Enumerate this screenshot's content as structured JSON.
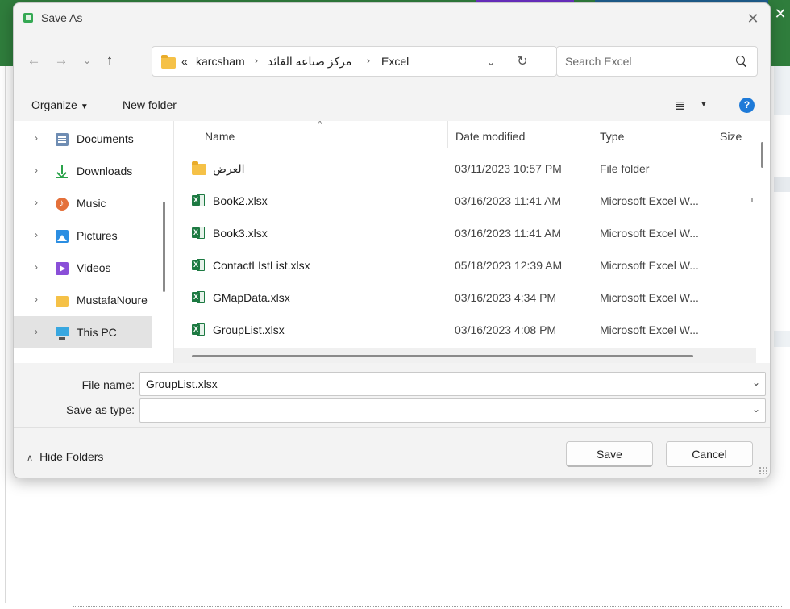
{
  "window": {
    "title": "Save As"
  },
  "address": {
    "overflow": "«",
    "crumbs": [
      "karcsham",
      "مركز صناعة القائد",
      "Excel"
    ],
    "separator": "›"
  },
  "search": {
    "placeholder": "Search Excel"
  },
  "toolbar": {
    "organize": "Organize",
    "new_folder": "New folder",
    "view_icon": "≣",
    "help": "?"
  },
  "sidebar": {
    "items": [
      {
        "label": "Documents",
        "icon": "documents-icon"
      },
      {
        "label": "Downloads",
        "icon": "downloads-icon"
      },
      {
        "label": "Music",
        "icon": "music-icon"
      },
      {
        "label": "Pictures",
        "icon": "pictures-icon"
      },
      {
        "label": "Videos",
        "icon": "videos-icon"
      },
      {
        "label": "MustafaNoure",
        "icon": "folder-icon"
      },
      {
        "label": "This PC",
        "icon": "pc-icon",
        "selected": true
      }
    ]
  },
  "files": {
    "columns": {
      "name": "Name",
      "date": "Date modified",
      "type": "Type",
      "size": "Size"
    },
    "rows": [
      {
        "name": "العرض",
        "date": "03/11/2023 10:57 PM",
        "type": "File folder",
        "kind": "folder"
      },
      {
        "name": "Book2.xlsx",
        "date": "03/16/2023 11:41 AM",
        "type": "Microsoft Excel W...",
        "kind": "excel"
      },
      {
        "name": "Book3.xlsx",
        "date": "03/16/2023 11:41 AM",
        "type": "Microsoft Excel W...",
        "kind": "excel"
      },
      {
        "name": "ContactLIstList.xlsx",
        "date": "05/18/2023 12:39 AM",
        "type": "Microsoft Excel W...",
        "kind": "excel"
      },
      {
        "name": "GMapData.xlsx",
        "date": "03/16/2023 4:34 PM",
        "type": "Microsoft Excel W...",
        "kind": "excel"
      },
      {
        "name": "GroupList.xlsx",
        "date": "03/16/2023 4:08 PM",
        "type": "Microsoft Excel W...",
        "kind": "excel"
      }
    ]
  },
  "form": {
    "file_name_label": "File name:",
    "file_name_value": "GroupList.xlsx",
    "save_type_label": "Save as type:",
    "save_type_value": ""
  },
  "footer": {
    "hide_folders": "Hide Folders",
    "save": "Save",
    "cancel": "Cancel"
  }
}
